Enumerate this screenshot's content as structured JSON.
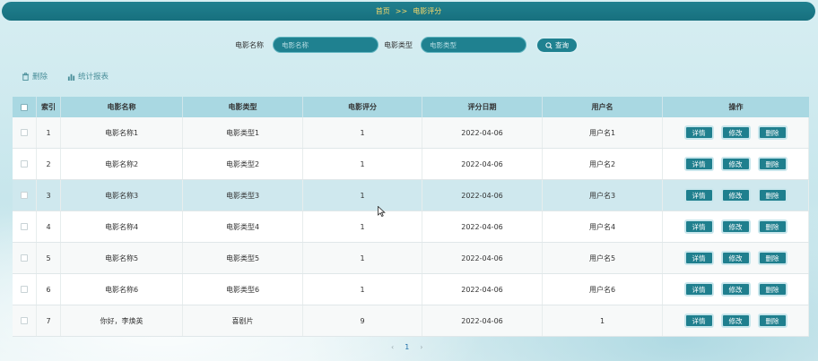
{
  "breadcrumb": {
    "home": "首页",
    "separator": ">>",
    "current": "电影评分"
  },
  "search": {
    "name_label": "电影名称",
    "name_placeholder": "电影名称",
    "type_label": "电影类型",
    "type_placeholder": "电影类型",
    "query_label": "查询"
  },
  "toolbar": {
    "delete_label": "删除",
    "report_label": "统计报表"
  },
  "table": {
    "columns": [
      "索引",
      "电影名称",
      "电影类型",
      "电影评分",
      "评分日期",
      "用户名",
      "操作"
    ],
    "rows": [
      {
        "index": "1",
        "name": "电影名称1",
        "type": "电影类型1",
        "score": "1",
        "date": "2022-04-06",
        "user": "用户名1"
      },
      {
        "index": "2",
        "name": "电影名称2",
        "type": "电影类型2",
        "score": "1",
        "date": "2022-04-06",
        "user": "用户名2"
      },
      {
        "index": "3",
        "name": "电影名称3",
        "type": "电影类型3",
        "score": "1",
        "date": "2022-04-06",
        "user": "用户名3"
      },
      {
        "index": "4",
        "name": "电影名称4",
        "type": "电影类型4",
        "score": "1",
        "date": "2022-04-06",
        "user": "用户名4"
      },
      {
        "index": "5",
        "name": "电影名称5",
        "type": "电影类型5",
        "score": "1",
        "date": "2022-04-06",
        "user": "用户名5"
      },
      {
        "index": "6",
        "name": "电影名称6",
        "type": "电影类型6",
        "score": "1",
        "date": "2022-04-06",
        "user": "用户名6"
      },
      {
        "index": "7",
        "name": "你好，李焕英",
        "type": "喜剧片",
        "score": "9",
        "date": "2022-04-06",
        "user": "1"
      }
    ],
    "actions": {
      "detail": "详情",
      "edit": "修改",
      "delete": "删除"
    }
  },
  "pagination": {
    "prev": "‹",
    "current_page": "1",
    "next": "›"
  },
  "colors": {
    "primary": "#1f8190",
    "header_bg": "#a9d8e2",
    "breadcrumb_text": "#f7d96a",
    "highlight_row": "#cfe8ee"
  }
}
